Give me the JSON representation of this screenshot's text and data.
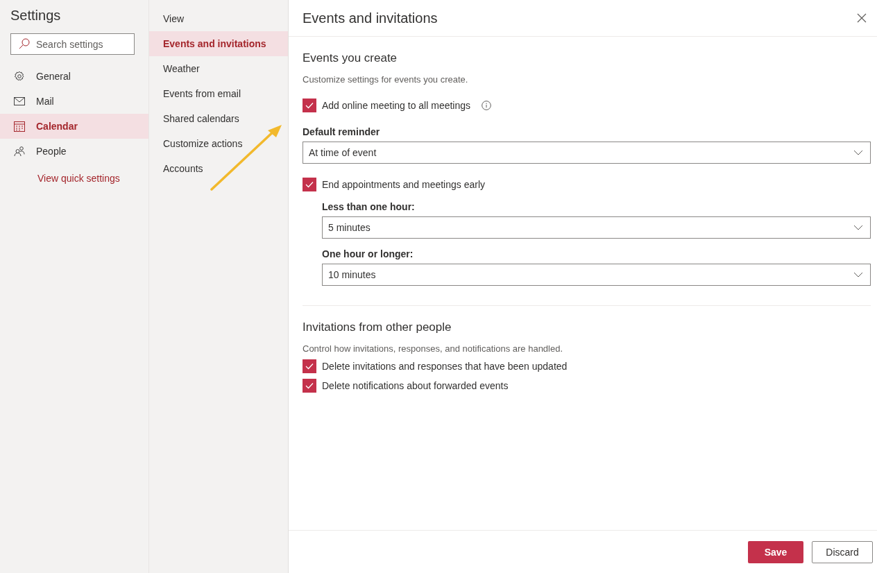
{
  "settings_nav": {
    "title": "Settings",
    "search": {
      "placeholder": "Search settings"
    },
    "items": [
      {
        "label": "General",
        "selected": false
      },
      {
        "label": "Mail",
        "selected": false
      },
      {
        "label": "Calendar",
        "selected": true
      },
      {
        "label": "People",
        "selected": false
      }
    ],
    "link": "View quick settings"
  },
  "sub_nav": {
    "items": [
      {
        "label": "View",
        "selected": false
      },
      {
        "label": "Events and invitations",
        "selected": true
      },
      {
        "label": "Weather",
        "selected": false
      },
      {
        "label": "Events from email",
        "selected": false
      },
      {
        "label": "Shared calendars",
        "selected": false
      },
      {
        "label": "Customize actions",
        "selected": false
      },
      {
        "label": "Accounts",
        "selected": false
      }
    ]
  },
  "panel": {
    "title": "Events and invitations",
    "sections": [
      {
        "heading": "Events you create",
        "description": "Customize settings for events you create.",
        "controls": [
          {
            "kind": "checkbox",
            "label": "Add online meeting to all meetings",
            "checked": true,
            "info": true
          },
          {
            "kind": "select",
            "label": "Default reminder",
            "value": "At time of event"
          },
          {
            "kind": "checkbox",
            "label": "End appointments and meetings early",
            "checked": true,
            "info": false,
            "children": [
              {
                "kind": "select",
                "label": "Less than one hour:",
                "value": "5 minutes"
              },
              {
                "kind": "select",
                "label": "One hour or longer:",
                "value": "10 minutes"
              }
            ]
          }
        ]
      },
      {
        "heading": "Invitations from other people",
        "description": "Control how invitations, responses, and notifications are handled.",
        "controls": [
          {
            "kind": "checkbox_compact",
            "label": "Delete invitations and responses that have been updated",
            "checked": true
          },
          {
            "kind": "checkbox_compact",
            "label": "Delete notifications about forwarded events",
            "checked": true
          }
        ]
      }
    ]
  },
  "footer": {
    "buttons": [
      {
        "label": "Save",
        "kind": "primary"
      },
      {
        "label": "Discard",
        "kind": "secondary"
      }
    ]
  }
}
